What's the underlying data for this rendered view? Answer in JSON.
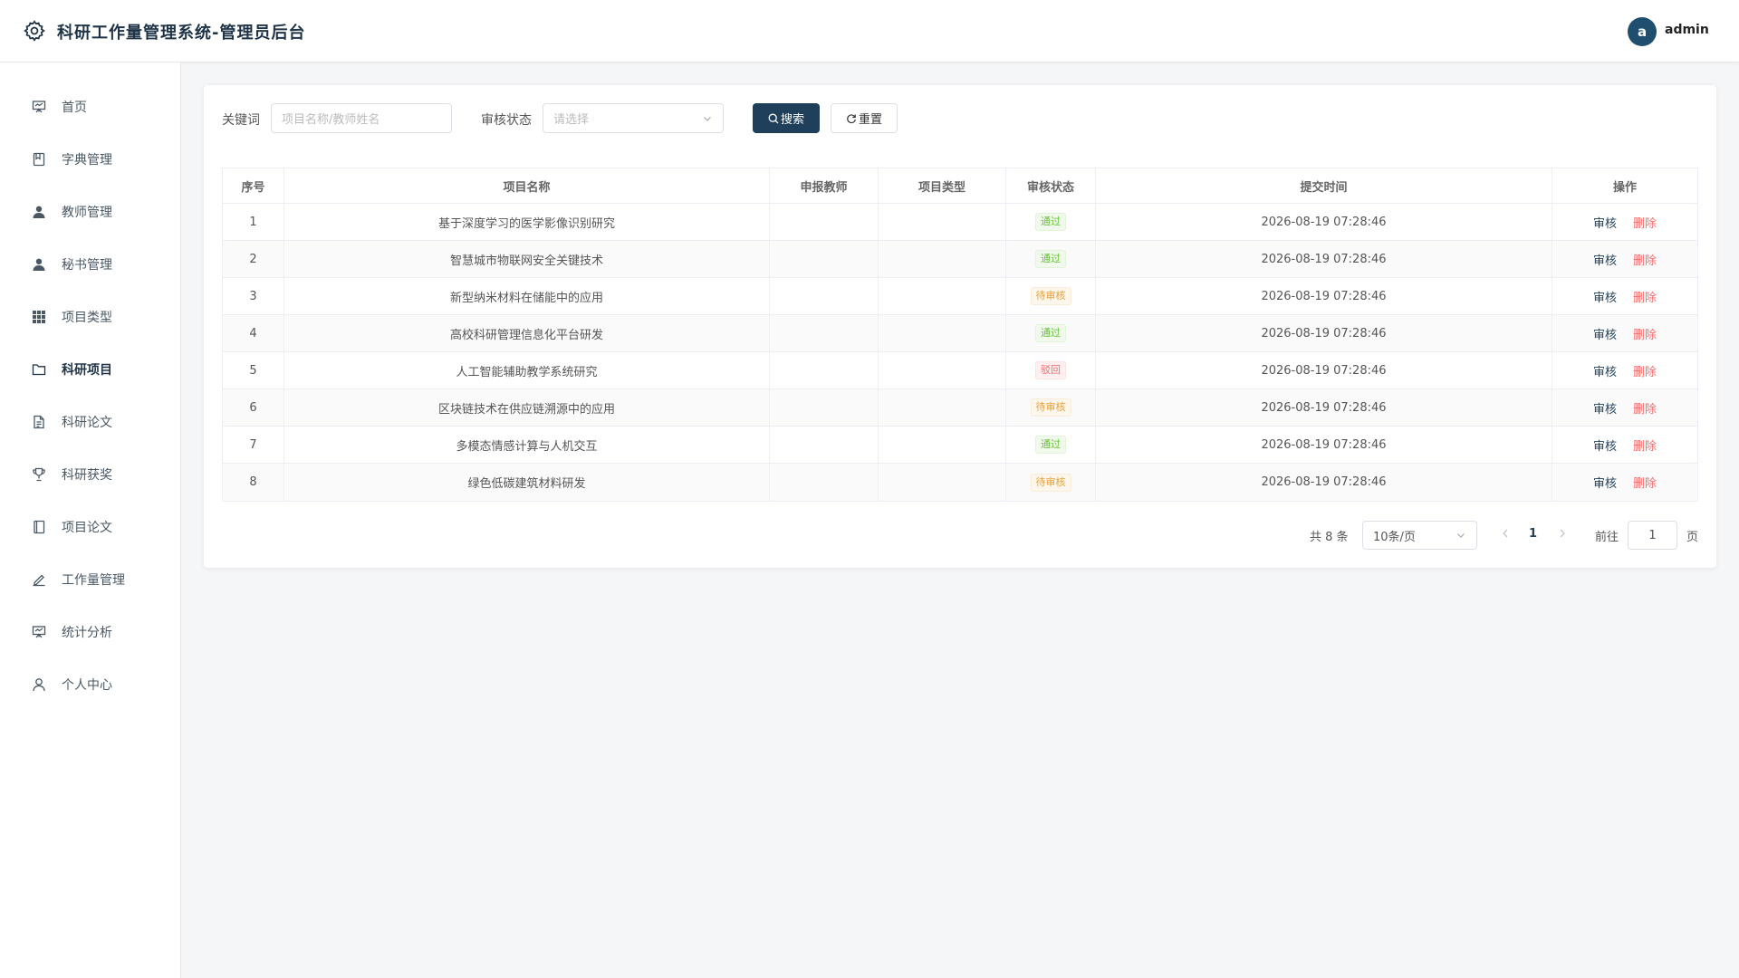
{
  "header": {
    "app_title": "科研工作量管理系统-管理员后台",
    "avatar_letter": "a",
    "username": "admin"
  },
  "sidebar": {
    "items": [
      {
        "label": "首页",
        "icon": "presentation-icon"
      },
      {
        "label": "字典管理",
        "icon": "book-icon"
      },
      {
        "label": "教师管理",
        "icon": "user-icon"
      },
      {
        "label": "秘书管理",
        "icon": "user-icon"
      },
      {
        "label": "项目类型",
        "icon": "grid-icon"
      },
      {
        "label": "科研项目",
        "icon": "folder-icon",
        "active": true
      },
      {
        "label": "科研论文",
        "icon": "document-icon"
      },
      {
        "label": "科研获奖",
        "icon": "trophy-icon"
      },
      {
        "label": "项目论文",
        "icon": "notebook-icon"
      },
      {
        "label": "工作量管理",
        "icon": "edit-icon"
      },
      {
        "label": "统计分析",
        "icon": "presentation-icon"
      },
      {
        "label": "个人中心",
        "icon": "user-outline-icon"
      }
    ]
  },
  "filters": {
    "keyword_label": "关键词",
    "keyword_placeholder": "项目名称/教师姓名",
    "status_label": "审核状态",
    "status_placeholder": "请选择",
    "search_label": "搜索",
    "reset_label": "重置"
  },
  "table": {
    "columns": [
      "序号",
      "项目名称",
      "申报教师",
      "项目类型",
      "审核状态",
      "提交时间",
      "操作"
    ],
    "rows": [
      {
        "index": "1",
        "name": "基于深度学习的医学影像识别研究",
        "teacher": "",
        "type": "",
        "status": "通过",
        "status_kind": "pass",
        "time": "2026-08-19 07:28:46"
      },
      {
        "index": "2",
        "name": "智慧城市物联网安全关键技术",
        "teacher": "",
        "type": "",
        "status": "通过",
        "status_kind": "pass",
        "time": "2026-08-19 07:28:46"
      },
      {
        "index": "3",
        "name": "新型纳米材料在储能中的应用",
        "teacher": "",
        "type": "",
        "status": "待审核",
        "status_kind": "pending",
        "time": "2026-08-19 07:28:46"
      },
      {
        "index": "4",
        "name": "高校科研管理信息化平台研发",
        "teacher": "",
        "type": "",
        "status": "通过",
        "status_kind": "pass",
        "time": "2026-08-19 07:28:46"
      },
      {
        "index": "5",
        "name": "人工智能辅助教学系统研究",
        "teacher": "",
        "type": "",
        "status": "驳回",
        "status_kind": "reject",
        "time": "2026-08-19 07:28:46"
      },
      {
        "index": "6",
        "name": "区块链技术在供应链溯源中的应用",
        "teacher": "",
        "type": "",
        "status": "待审核",
        "status_kind": "pending",
        "time": "2026-08-19 07:28:46"
      },
      {
        "index": "7",
        "name": "多模态情感计算与人机交互",
        "teacher": "",
        "type": "",
        "status": "通过",
        "status_kind": "pass",
        "time": "2026-08-19 07:28:46"
      },
      {
        "index": "8",
        "name": "绿色低碳建筑材料研发",
        "teacher": "",
        "type": "",
        "status": "待审核",
        "status_kind": "pending",
        "time": "2026-08-19 07:28:46"
      }
    ],
    "actions": {
      "audit": "审核",
      "delete": "删除"
    }
  },
  "pagination": {
    "total": "共 8 条",
    "page_size": "10条/页",
    "current_page": "1",
    "goto_label": "前往",
    "goto_value": "1",
    "page_unit": "页"
  },
  "colors": {
    "primary": "#1f3f5b",
    "pass": "#67c23a",
    "pending": "#e6a23c",
    "reject": "#f56c6c"
  }
}
